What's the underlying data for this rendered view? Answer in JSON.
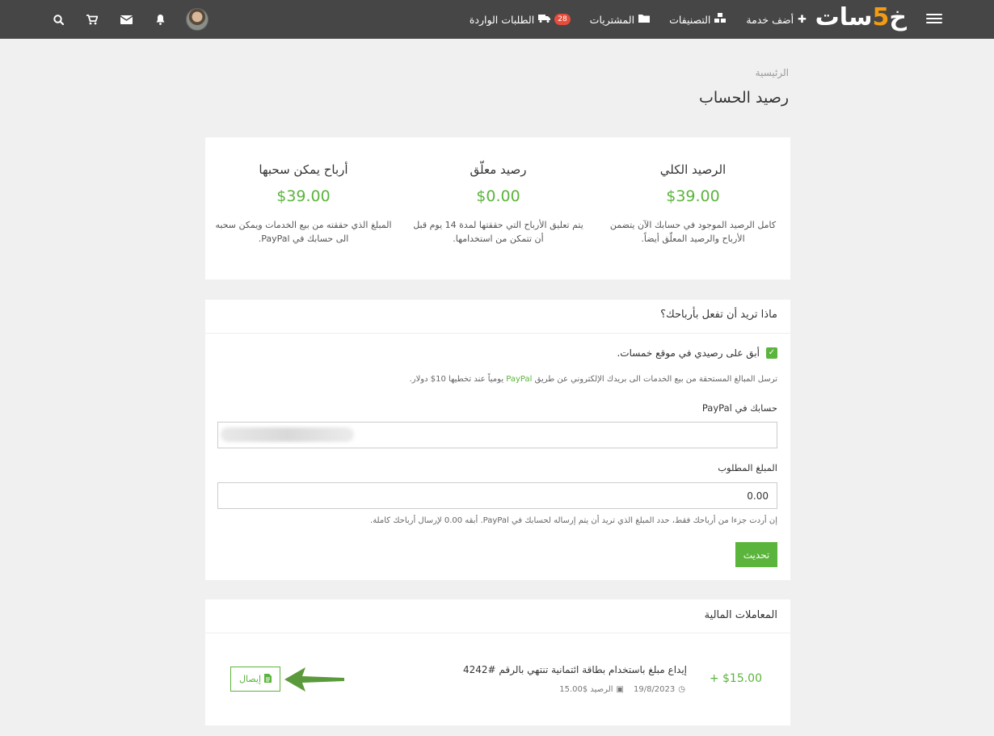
{
  "nav": {
    "logo": {
      "text_a": "خ",
      "text_five": "5",
      "text_b": "سات"
    },
    "links": [
      {
        "label": "أضف خدمة",
        "icon": "plus-icon"
      },
      {
        "label": "التصنيفات",
        "icon": "cubes-icon"
      },
      {
        "label": "المشتريات",
        "icon": "folder-icon"
      },
      {
        "label": "الطلبات الواردة",
        "icon": "truck-icon",
        "badge": "28"
      }
    ],
    "icons": [
      "search-icon",
      "cart-icon",
      "envelope-icon",
      "bell-icon",
      "avatar"
    ]
  },
  "breadcrumb": "الرئيسية",
  "page_title": "رصيد الحساب",
  "balances": [
    {
      "title": "الرصيد الكلي",
      "amount": "$39.00",
      "desc": "كامل الرصيد الموجود في حسابك الآن يتضمن الأرباح والرصيد المعلّق أيضاً."
    },
    {
      "title": "رصيد معلّق",
      "amount": "$0.00",
      "desc": "يتم تعليق الأرباح التي حققتها لمدة 14 يوم قبل أن تتمكن من استخدامها."
    },
    {
      "title": "أرباح يمكن سحبها",
      "amount": "$39.00",
      "desc": "المبلغ الذي حققته من بيع الخدمات ويمكن سحبه الى حسابك في PayPal."
    }
  ],
  "earnings": {
    "heading": "ماذا تريد أن تفعل بأرباحك؟",
    "checkbox_label": "أبق على رصيدي في موقع خمسات.",
    "note_prefix": "ترسل المبالغ المستحقة من بيع الخدمات الى بريدك الإلكتروني عن طريق",
    "note_paypal": "PayPal",
    "note_suffix": "يومياً عند تخطيها 10$ دولار.",
    "paypal_label": "حسابك في PayPal",
    "amount_label": "المبلغ المطلوب",
    "amount_value": "0.00",
    "hint": "إن أردت جزءا من أرباحك فقط، حدد المبلغ الذي تريد أن يتم إرساله لحسابك في PayPal. أبقه 0.00 لإرسال أرباحك كاملة.",
    "update_button": "تحديث"
  },
  "transactions": {
    "heading": "المعاملات المالية",
    "items": [
      {
        "amount": "+ $15.00",
        "description": "إيداع مبلغ باستخدام بطاقة ائتمانية تنتهي بالرقم #4242",
        "date": "19/8/2023",
        "balance": "الرصيد $15.00",
        "receipt_button": "إيصال"
      }
    ]
  },
  "colors": {
    "nav_bg": "#464646",
    "accent_green": "#5bb43c",
    "arrow_green": "#5a9a3c",
    "badge_red": "#e74c3c",
    "logo_orange": "#f39c12"
  }
}
